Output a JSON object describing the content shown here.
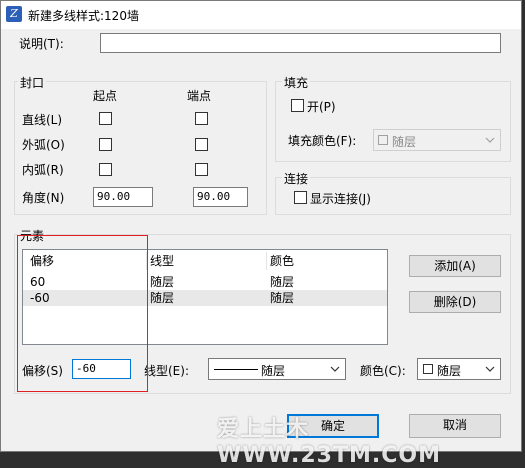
{
  "window": {
    "title": "新建多线样式:120墙"
  },
  "description": {
    "label": "说明(T):",
    "value": ""
  },
  "caps": {
    "group_label": "封口",
    "start_header": "起点",
    "end_header": "端点",
    "rows": [
      {
        "label": "直线(L)",
        "start": false,
        "end": false
      },
      {
        "label": "外弧(O)",
        "start": false,
        "end": false
      },
      {
        "label": "内弧(R)",
        "start": false,
        "end": false
      }
    ],
    "angle_label": "角度(N)",
    "angle_start": "90.00",
    "angle_end": "90.00"
  },
  "fill": {
    "group_label": "填充",
    "on_label": "开(P)",
    "on_checked": false,
    "color_label": "填充颜色(F):",
    "color_value": "随层"
  },
  "connect": {
    "group_label": "连接",
    "show_label": "显示连接(J)",
    "show_checked": false
  },
  "elements": {
    "group_label": "元素",
    "columns": [
      "偏移",
      "线型",
      "颜色"
    ],
    "rows": [
      {
        "offset": "60",
        "linetype": "随层",
        "color": "随层",
        "selected": false
      },
      {
        "offset": "-60",
        "linetype": "随层",
        "color": "随层",
        "selected": true
      }
    ],
    "add_label": "添加(A)",
    "delete_label": "删除(D)",
    "offset_label": "偏移(S)",
    "offset_value": "-60",
    "linetype_label": "线型(E):",
    "linetype_value": "随层",
    "color_label": "颜色(C):",
    "color_value": "随层"
  },
  "footer": {
    "ok_label": "确定",
    "cancel_label": "取消"
  },
  "watermark": "爱上土木WWW.23TM.COM",
  "colors": {
    "highlight_box": "#e02020"
  }
}
